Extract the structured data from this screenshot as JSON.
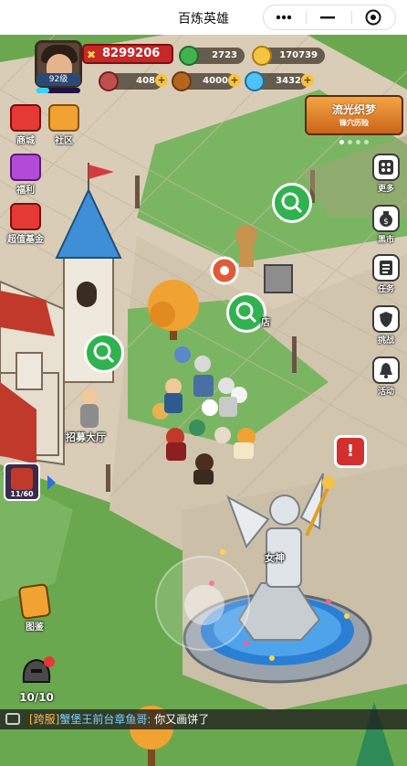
{
  "app": {
    "title": "百炼英雄"
  },
  "player": {
    "level": "92级",
    "power": "8299206"
  },
  "resources": [
    {
      "name": "gems",
      "value": "2723",
      "icon": "green-gem-icon",
      "color": "#3fb34f"
    },
    {
      "name": "gold",
      "value": "170739",
      "icon": "gold-coin-icon",
      "color": "#f5c542"
    },
    {
      "name": "meat",
      "value": "408",
      "icon": "meat-icon",
      "color": "#c0504d"
    },
    {
      "name": "wood",
      "value": "4000",
      "icon": "wood-log-icon",
      "color": "#b5651d"
    },
    {
      "name": "crystal",
      "value": "3432",
      "icon": "crystal-icon",
      "color": "#4fc3f7"
    }
  ],
  "left_menu": [
    {
      "label": "商城",
      "icon": "shop-icon"
    },
    {
      "label": "社区",
      "icon": "community-house-icon"
    },
    {
      "label": "福利",
      "icon": "gift-box-icon"
    },
    {
      "label": "超值基金",
      "icon": "fund-chart-icon"
    }
  ],
  "right_menu": [
    {
      "label": "更多",
      "icon": "more-dice-icon"
    },
    {
      "label": "黑市",
      "icon": "money-bag-icon"
    },
    {
      "label": "任务",
      "icon": "task-list-icon"
    },
    {
      "label": "挑战",
      "icon": "shield-icon"
    },
    {
      "label": "活动",
      "icon": "bell-icon"
    }
  ],
  "event_banner": {
    "title": "流光织梦",
    "subtitle": "锋穴历险"
  },
  "map_labels": {
    "recruit_hall": "招募大厅",
    "goddess": "女神",
    "shop_stub": "店"
  },
  "hero_card": {
    "count": "11/60"
  },
  "codex": {
    "label": "图鉴"
  },
  "helmet": {
    "count": "10/10"
  },
  "chat": {
    "channel": "[跨服]",
    "user": "蟹堡王前台章鱼哥:",
    "message": " 你又画饼了"
  },
  "colors": {
    "grass": "#6aa84f",
    "path": "#d9cdb8",
    "water": "#2a7fd4",
    "accent": "#c62828"
  }
}
